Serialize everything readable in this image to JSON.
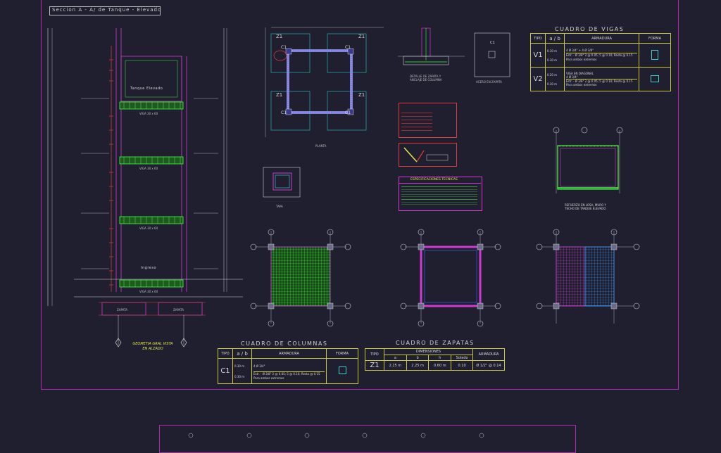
{
  "section": {
    "title": "Seccion A - A/ de Tanque - Elevado",
    "tank_label": "Tanque Elevado",
    "beam_label": "VIGA 30 x 60",
    "entry_label": "Ingreso",
    "footing_label": "ZAPATA",
    "elevation_caption": "GEOMETIA GRAL VISTA EN ALZADO"
  },
  "plan": {
    "z_label": "Z1",
    "c_label": "C1",
    "caption": "PLANTA"
  },
  "details": {
    "footing_anchor": "DETALLE DE ZAPATA Y ANCLAJE DE COLUMNA",
    "footing_steel": "ACERO EN ZAPATA",
    "lid": "TAPA",
    "tank_reinforcement": "REFUERZO EN LOSA, MURO Y TECHO DE TANQUE ELEVADO"
  },
  "specs": {
    "title": "ESPECIFICACIONES TECNICAS"
  },
  "beams_table": {
    "title": "CUADRO DE VIGAS",
    "col_tipo": "TIPO",
    "col_a": "a",
    "col_b": "b",
    "col_armadura": "ARMADURA",
    "col_forma": "FORMA",
    "v1_tipo": "V1",
    "v1_h": "0.30 m",
    "v1_w": "0.30 m",
    "v1_arm": "4 Ø 3/4\" + 4 Ø 3/8\"",
    "v1_est": "Estr. - Ø 3/8\" 2 @ 0.05; 5 @ 0.10; Resto @ 0.15",
    "v1_note": "Para ambos extremos",
    "v2_tipo": "V2",
    "v2_h": "0.20 m",
    "v2_w": "0.30 m",
    "v2_arm1": "VIGA EN DIAGONAL",
    "v2_arm2": "4 Ø 3/4\"",
    "v2_est": "Estr. - Ø 3/8\" 2 @ 0.05; 5 @ 0.10; Resto @ 0.15",
    "v2_note": "Para ambos extremos"
  },
  "columns_table": {
    "title": "CUADRO DE COLUMNAS",
    "col_tipo": "TIPO",
    "col_a": "a",
    "col_b": "b",
    "col_armadura": "ARMADURA",
    "col_forma": "FORMA",
    "c1_tipo": "C1",
    "c1_h": "0.30 m",
    "c1_w": "0.30 m",
    "c1_arm": "4 Ø 3/4\"",
    "c1_est": "Estr. - Ø 3/8\" 2 @ 0.05; 5 @ 0.10; Resto @ 0.15",
    "c1_note": "Para ambos extremos"
  },
  "footings_table": {
    "title": "CUADRO DE ZAPATAS",
    "col_tipo": "TIPO",
    "col_dim": "DIMENSIONES",
    "col_armadura": "ARMADURA",
    "col_a": "a",
    "col_b": "b",
    "col_h": "h",
    "col_solado": "Solado",
    "z1_tipo": "Z1",
    "z1_a": "2.25 m",
    "z1_b": "2.25 m",
    "z1_h": "0.60 m",
    "z1_solado": "0.10",
    "z1_arm": "Ø 1/2\" @ 0.14"
  }
}
